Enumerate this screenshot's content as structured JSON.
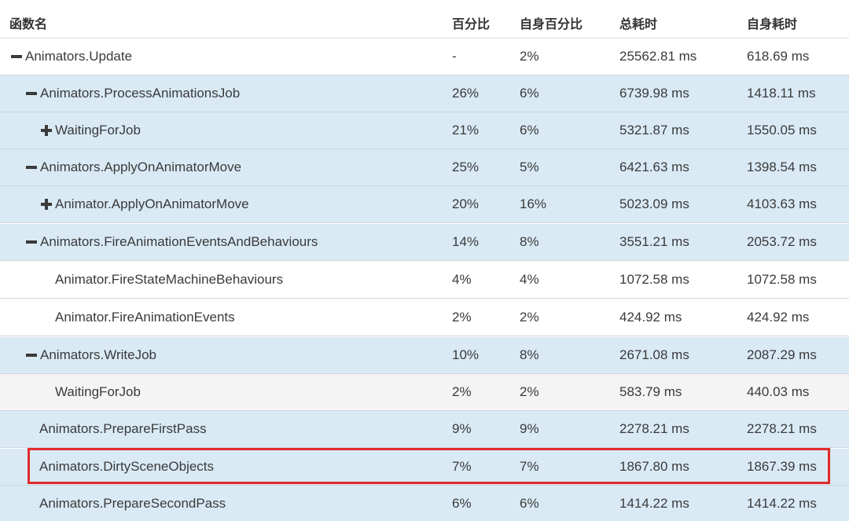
{
  "header": {
    "name": "函数名",
    "pct": "百分比",
    "self_pct": "自身百分比",
    "total": "总耗时",
    "self_time": "自身耗时"
  },
  "rows": [
    {
      "toggle": "minus",
      "name": "Animators.Update",
      "pct": "-",
      "self_pct": "2%",
      "total": "25562.81 ms",
      "self_time": "618.69 ms"
    },
    {
      "toggle": "minus",
      "name": "Animators.ProcessAnimationsJob",
      "pct": "26%",
      "self_pct": "6%",
      "total": "6739.98 ms",
      "self_time": "1418.11 ms"
    },
    {
      "toggle": "plus",
      "name": "WaitingForJob",
      "pct": "21%",
      "self_pct": "6%",
      "total": "5321.87 ms",
      "self_time": "1550.05 ms"
    },
    {
      "toggle": "minus",
      "name": "Animators.ApplyOnAnimatorMove",
      "pct": "25%",
      "self_pct": "5%",
      "total": "6421.63 ms",
      "self_time": "1398.54 ms"
    },
    {
      "toggle": "plus",
      "name": "Animator.ApplyOnAnimatorMove",
      "pct": "20%",
      "self_pct": "16%",
      "total": "5023.09 ms",
      "self_time": "4103.63 ms"
    },
    {
      "toggle": "minus",
      "name": "Animators.FireAnimationEventsAndBehaviours",
      "pct": "14%",
      "self_pct": "8%",
      "total": "3551.21 ms",
      "self_time": "2053.72 ms"
    },
    {
      "toggle": "",
      "name": "Animator.FireStateMachineBehaviours",
      "pct": "4%",
      "self_pct": "4%",
      "total": "1072.58 ms",
      "self_time": "1072.58 ms"
    },
    {
      "toggle": "",
      "name": "Animator.FireAnimationEvents",
      "pct": "2%",
      "self_pct": "2%",
      "total": "424.92 ms",
      "self_time": "424.92 ms"
    },
    {
      "toggle": "minus",
      "name": "Animators.WriteJob",
      "pct": "10%",
      "self_pct": "8%",
      "total": "2671.08 ms",
      "self_time": "2087.29 ms"
    },
    {
      "toggle": "",
      "name": "WaitingForJob",
      "pct": "2%",
      "self_pct": "2%",
      "total": "583.79 ms",
      "self_time": "440.03 ms"
    },
    {
      "toggle": "",
      "name": "Animators.PrepareFirstPass",
      "pct": "9%",
      "self_pct": "9%",
      "total": "2278.21 ms",
      "self_time": "2278.21 ms"
    },
    {
      "toggle": "",
      "name": "Animators.DirtySceneObjects",
      "pct": "7%",
      "self_pct": "7%",
      "total": "1867.80 ms",
      "self_time": "1867.39 ms"
    },
    {
      "toggle": "",
      "name": "Animators.PrepareSecondPass",
      "pct": "6%",
      "self_pct": "6%",
      "total": "1414.22 ms",
      "self_time": "1414.22 ms"
    }
  ],
  "colors": {
    "row_blue": "#d9eaf5",
    "row_white": "#ffffff",
    "row_grey": "#f4f4f4",
    "highlight": "#e02b2b"
  }
}
